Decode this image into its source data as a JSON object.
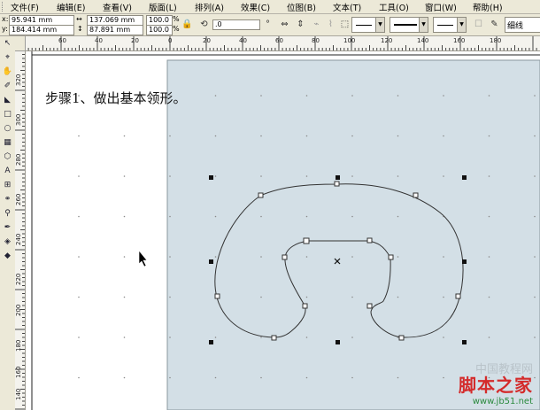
{
  "menu": [
    "文件(F)",
    "编辑(E)",
    "查看(V)",
    "版面(L)",
    "排列(A)",
    "效果(C)",
    "位图(B)",
    "文本(T)",
    "工具(O)",
    "窗口(W)",
    "帮助(H)"
  ],
  "propbar": {
    "x_label": "x:",
    "x_value": "95.941 mm",
    "y_label": "y:",
    "y_value": "184.414 mm",
    "width_value": "137.069 mm",
    "height_value": "87.891 mm",
    "scale_x": "100.0",
    "scale_y": "100.0",
    "scale_unit_x": "%",
    "scale_unit_y": "%",
    "rotation_value": ".0",
    "outline_width": "细线"
  },
  "rulers": {
    "top_labels": [
      "60",
      "40",
      "20",
      "0",
      "20",
      "40",
      "60",
      "80",
      "100",
      "120",
      "140",
      "160",
      "180"
    ],
    "left_labels": [
      "320",
      "300",
      "280",
      "260",
      "240",
      "220",
      "200",
      "180",
      "160",
      "140",
      "120"
    ]
  },
  "canvas": {
    "step_text": "步骤1、做出基本领形。"
  },
  "watermark": {
    "faint_text": "中国教程网",
    "main": "脚本之家",
    "url": "www.jb51.net"
  },
  "colors": {
    "page_fill": "#d3dfe6",
    "desktop": "#ffffff",
    "ui_face": "#ece9d8",
    "watermark_red": "#d42b2b"
  }
}
